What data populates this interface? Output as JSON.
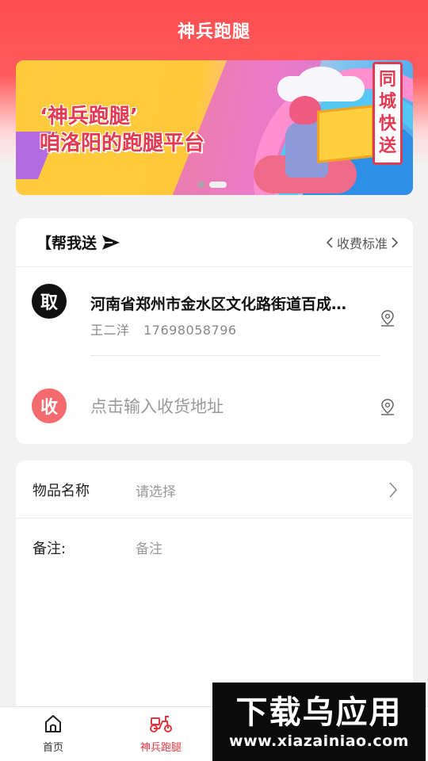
{
  "header": {
    "title": "神兵跑腿"
  },
  "banner": {
    "line1": "‘神兵跑腿’",
    "line2": "咱洛阳的跑腿平台",
    "badge": [
      "同",
      "城",
      "快",
      "送"
    ]
  },
  "send_card": {
    "title": "【帮我送",
    "fee_label": "收费标准",
    "pickup": {
      "marker": "取",
      "address": "河南省郑州市金水区文化路街道百成…",
      "contact_name": "王二洋",
      "contact_phone": "17698058796"
    },
    "delivery": {
      "marker": "收",
      "placeholder": "点击输入收货地址"
    }
  },
  "item_card": {
    "item_label": "物品名称",
    "item_placeholder": "请选择",
    "note_label": "备注:",
    "note_placeholder": "备注"
  },
  "tabbar": {
    "tabs": [
      {
        "label": "首页",
        "icon": "home-icon"
      },
      {
        "label": "神兵跑腿",
        "icon": "scooter-icon"
      }
    ]
  },
  "watermark": {
    "title": "下载乌应用",
    "url": "www.xiazainiao.com"
  },
  "colors": {
    "brand_red": "#ff4d4f",
    "tab_active": "#e2373e",
    "pickup_marker": "#111111",
    "delivery_marker": "#f46a6e"
  }
}
